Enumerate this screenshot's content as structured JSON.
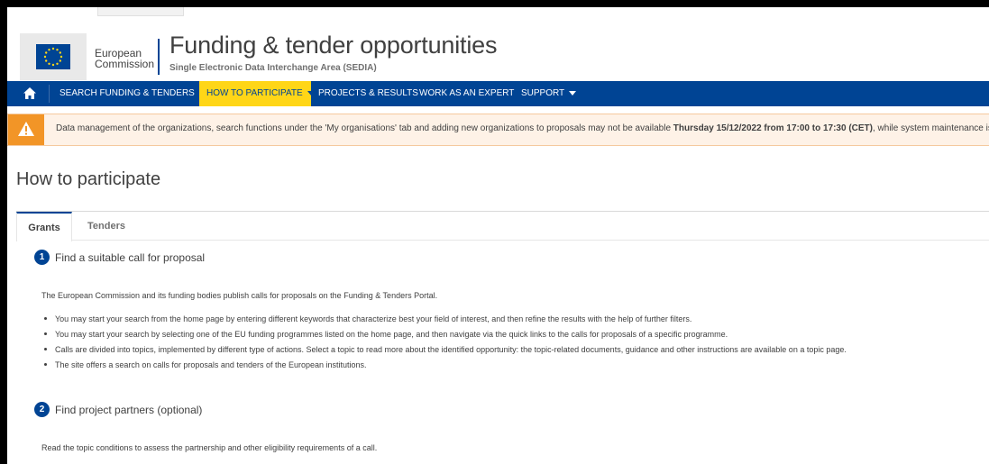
{
  "header": {
    "org_line1": "European",
    "org_line2": "Commission",
    "title": "Funding & tender opportunities",
    "subtitle": "Single Electronic Data Interchange Area (SEDIA)"
  },
  "nav": {
    "items": [
      {
        "label": "SEARCH FUNDING & TENDERS",
        "has_dropdown": true
      },
      {
        "label": "HOW TO PARTICIPATE",
        "has_dropdown": true,
        "active": true
      },
      {
        "label": "PROJECTS & RESULTS",
        "has_dropdown": false
      },
      {
        "label": "WORK AS AN EXPERT",
        "has_dropdown": false
      },
      {
        "label": "SUPPORT",
        "has_dropdown": true
      }
    ]
  },
  "notice": {
    "text_before": "Data management of the organizations, search functions under the 'My organisations' tab and adding new organizations to proposals may not be available ",
    "text_bold": "Thursday 15/12/2022 from 17:00 to 17:30 (CET)",
    "text_after": ", while system maintenance is being"
  },
  "page": {
    "title": "How to participate"
  },
  "tabs": [
    {
      "label": "Grants",
      "active": true
    },
    {
      "label": "Tenders",
      "active": false
    }
  ],
  "steps": [
    {
      "number": "1",
      "title": "Find a suitable call for proposal",
      "intro": "The European Commission and its funding bodies publish calls for proposals on the Funding & Tenders Portal.",
      "bullets": [
        "You may start your search from the home page by entering different keywords that characterize best your field of interest, and then refine the results with the help of further filters.",
        "You may start your search by selecting one of the EU funding programmes listed on the home page, and then navigate via the quick links to the calls for proposals of a specific programme.",
        "Calls are divided into topics, implemented by different type of actions. Select a topic to read more about the identified opportunity: the topic-related documents, guidance and other instructions are available on a topic page.",
        "The site offers a search on calls for proposals and tenders of the European institutions."
      ]
    },
    {
      "number": "2",
      "title": "Find project partners (optional)",
      "intro": "Read the topic conditions to assess the partnership and other eligibility requirements of a call."
    }
  ],
  "colors": {
    "primary_blue": "#004494",
    "accent_yellow": "#ffd617",
    "warning_orange": "#f29527"
  },
  "icons": {
    "home": "home-icon",
    "warning": "warning-icon",
    "logo": "ec-flag-logo"
  }
}
